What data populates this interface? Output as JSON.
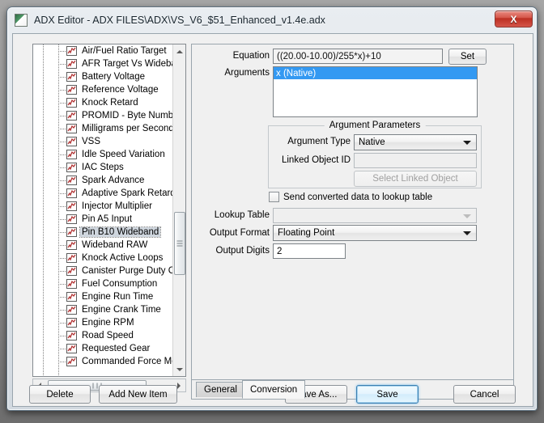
{
  "window": {
    "title": "ADX Editor - ADX FILES\\ADX\\VS_V6_$51_Enhanced_v1.4e.adx",
    "app_icon": "adx-app-icon",
    "close_label": "X"
  },
  "tree": {
    "items": [
      {
        "label": "Air/Fuel Ratio Target",
        "selected": false
      },
      {
        "label": "AFR Target Vs Wideban",
        "selected": false
      },
      {
        "label": "Battery Voltage",
        "selected": false
      },
      {
        "label": "Reference Voltage",
        "selected": false
      },
      {
        "label": "Knock Retard",
        "selected": false
      },
      {
        "label": "PROMID - Byte Number",
        "selected": false
      },
      {
        "label": "Milligrams per Second pe",
        "selected": false
      },
      {
        "label": "VSS",
        "selected": false
      },
      {
        "label": "Idle Speed Variation",
        "selected": false
      },
      {
        "label": "IAC Steps",
        "selected": false
      },
      {
        "label": "Spark Advance",
        "selected": false
      },
      {
        "label": "Adaptive Spark Retard",
        "selected": false
      },
      {
        "label": "Injector Multiplier",
        "selected": false
      },
      {
        "label": "Pin A5 Input",
        "selected": false
      },
      {
        "label": "Pin B10 Wideband",
        "selected": true
      },
      {
        "label": "Wideband RAW",
        "selected": false
      },
      {
        "label": "Knock Active Loops",
        "selected": false
      },
      {
        "label": "Canister Purge Duty Cyc",
        "selected": false
      },
      {
        "label": "Fuel Consumption",
        "selected": false
      },
      {
        "label": "Engine Run Time",
        "selected": false
      },
      {
        "label": "Engine Crank Time",
        "selected": false
      },
      {
        "label": "Engine RPM",
        "selected": false
      },
      {
        "label": "Road Speed",
        "selected": false
      },
      {
        "label": "Requested Gear",
        "selected": false
      },
      {
        "label": "Commanded Force Moto",
        "selected": false
      }
    ],
    "item_icon": "line-chart-icon",
    "vscroll": {
      "up_icon": "scroll-up-arrow-icon",
      "down_icon": "scroll-down-arrow-icon",
      "thumb": "vertical-scroll-thumb"
    },
    "hscroll": {
      "left_icon": "scroll-left-arrow-icon",
      "right_icon": "scroll-right-arrow-icon",
      "thumb": "horizontal-scroll-thumb"
    }
  },
  "tabs": {
    "general_label": "General",
    "conversion_label": "Conversion",
    "active": "Conversion"
  },
  "form": {
    "equation_label": "Equation",
    "equation_value": "((20.00-10.00)/255*x)+10",
    "set_label": "Set",
    "arguments_label": "Arguments",
    "arguments": [
      "x (Native)"
    ],
    "argparams_legend": "Argument Parameters",
    "argument_type_label": "Argument Type",
    "argument_type_value": "Native",
    "linked_object_id_label": "Linked Object ID",
    "linked_object_id_value": "",
    "select_linked_object_label": "Select Linked Object",
    "send_converted_label": "Send converted data to lookup table",
    "send_converted_checked": false,
    "lookup_table_label": "Lookup Table",
    "lookup_table_value": "",
    "output_format_label": "Output Format",
    "output_format_value": "Floating Point",
    "output_digits_label": "Output Digits",
    "output_digits_value": "2"
  },
  "buttons": {
    "delete": "Delete",
    "add_new_item": "Add New Item",
    "save_as": "Save As...",
    "save": "Save",
    "cancel": "Cancel"
  },
  "colors": {
    "selection_blue": "#3399f2",
    "close_red": "#bc2f22",
    "default_focus_blue": "#3c7fb1",
    "icon_red": "#b03030"
  }
}
